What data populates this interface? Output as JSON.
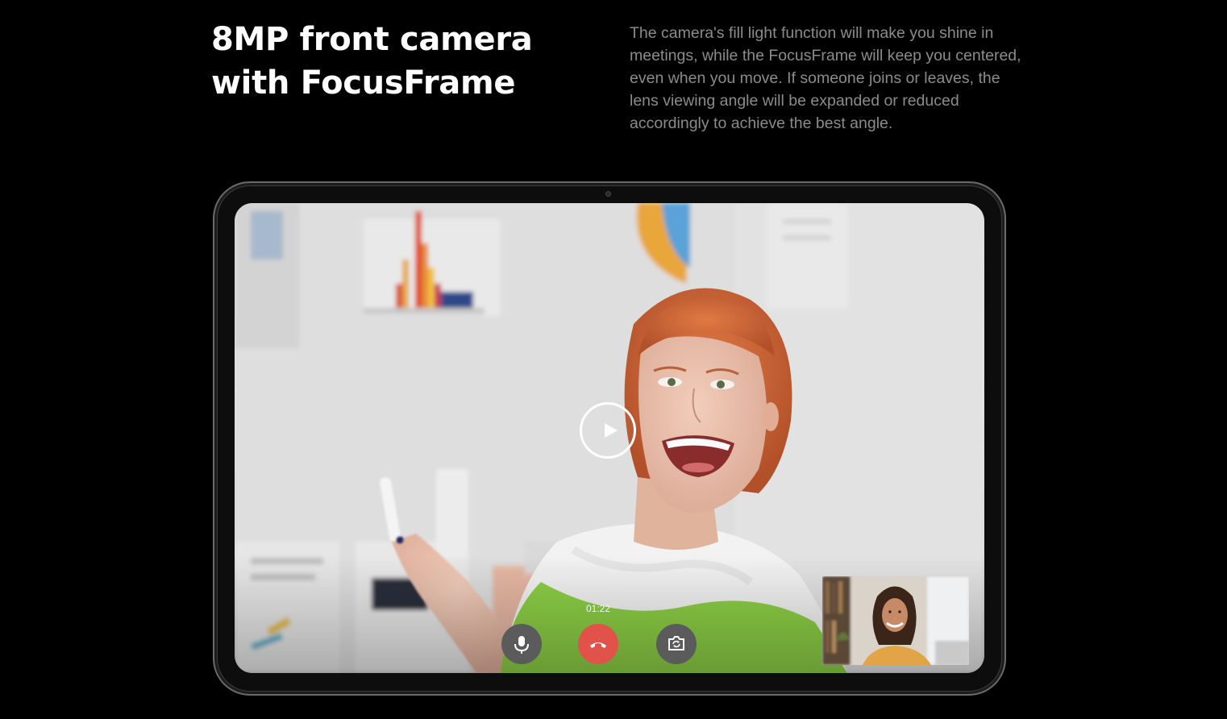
{
  "hero": {
    "headline_line1": "8MP front camera",
    "headline_line2": "with FocusFrame",
    "description": "The camera's fill light function will make you shine in meetings, while the FocusFrame will keep you centered, even when you move. If someone joins or leaves, the lens viewing angle will be expanded or reduced accordingly to achieve the best angle."
  },
  "video": {
    "call_timer": "01:22",
    "icons": {
      "play": "play-icon",
      "mic": "microphone-icon",
      "hangup": "phone-hangup-icon",
      "flip": "camera-flip-icon"
    },
    "colors": {
      "hangup": "#e0524a",
      "control": "#5b5b5b",
      "sweater_green": "#8ccf45"
    }
  }
}
